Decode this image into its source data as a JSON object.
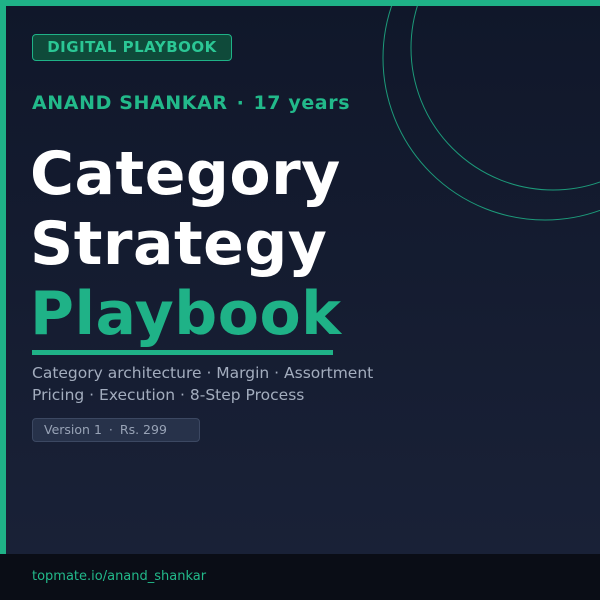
{
  "badge": {
    "label": "DIGITAL PLAYBOOK"
  },
  "author": {
    "name": "ANAND SHANKAR",
    "separator": "·",
    "experience": "17 years"
  },
  "title": {
    "line1": "Category",
    "line2": "Strategy",
    "line3": "Playbook"
  },
  "tagline": {
    "line1": "Category architecture · Margin · Assortment",
    "line2": "Pricing · Execution · 8-Step Process"
  },
  "version": {
    "label": "Version 1",
    "separator": "·",
    "price": "Rs. 299"
  },
  "footer": {
    "link": "topmate.io/anand_shankar"
  },
  "colors": {
    "accent": "#1fb287",
    "background_top": "#10172a",
    "background_bottom": "#1a2238",
    "footer_bg": "#0a0d16",
    "title_text": "#ffffff",
    "muted_text": "#a3adbe"
  }
}
